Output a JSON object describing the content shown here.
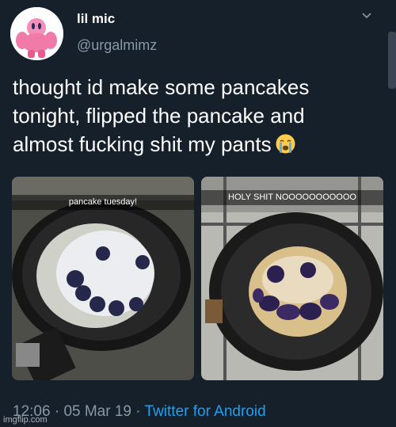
{
  "author": {
    "name": "lil mic",
    "handle": "@urgalmimz",
    "avatar": "muscular-kirby-avatar"
  },
  "tweet": {
    "lines": [
      "thought id make some pancakes",
      "tonight, flipped the pancake and",
      "almost fucking shit my pants"
    ],
    "emoji": "loudly-crying-face-emoji"
  },
  "photos": [
    {
      "caption": "pancake tuesday!"
    },
    {
      "caption": "HOLY SHIT NOOOOOOOOOOO"
    }
  ],
  "meta": {
    "time": "12:06",
    "sep1": "·",
    "date": "05 Mar 19",
    "sep2": "·",
    "source": "Twitter for Android"
  },
  "watermark": "imgflip.com",
  "colors": {
    "background": "#15202b",
    "secondary_text": "#8899a6",
    "link": "#1da1f2"
  }
}
